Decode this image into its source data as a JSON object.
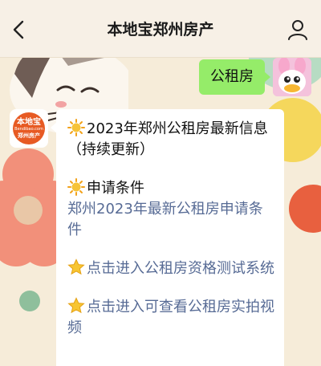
{
  "header": {
    "title": "本地宝郑州房产",
    "back_icon": "chevron-left-icon",
    "profile_icon": "person-icon"
  },
  "chat": {
    "user_message": "公租房",
    "bot_avatar": {
      "logo_main": "本地宝",
      "logo_sub": "Bendibao.com",
      "logo_tag": "郑州房产"
    },
    "bot_message": {
      "block1_text": "2023年郑州公租房最新信息（持续更新）",
      "block2_heading": "申请条件",
      "block2_link": "郑州2023年最新公租房申请条件",
      "block3_link": "点击进入公租房资格测试系统",
      "block4_link": "点击进入可查看公租房实拍视频"
    }
  },
  "colors": {
    "user_bubble": "#95ec69",
    "link": "#576b95",
    "wallpaper": "#f6ecd9",
    "logo": "#e75a23"
  }
}
